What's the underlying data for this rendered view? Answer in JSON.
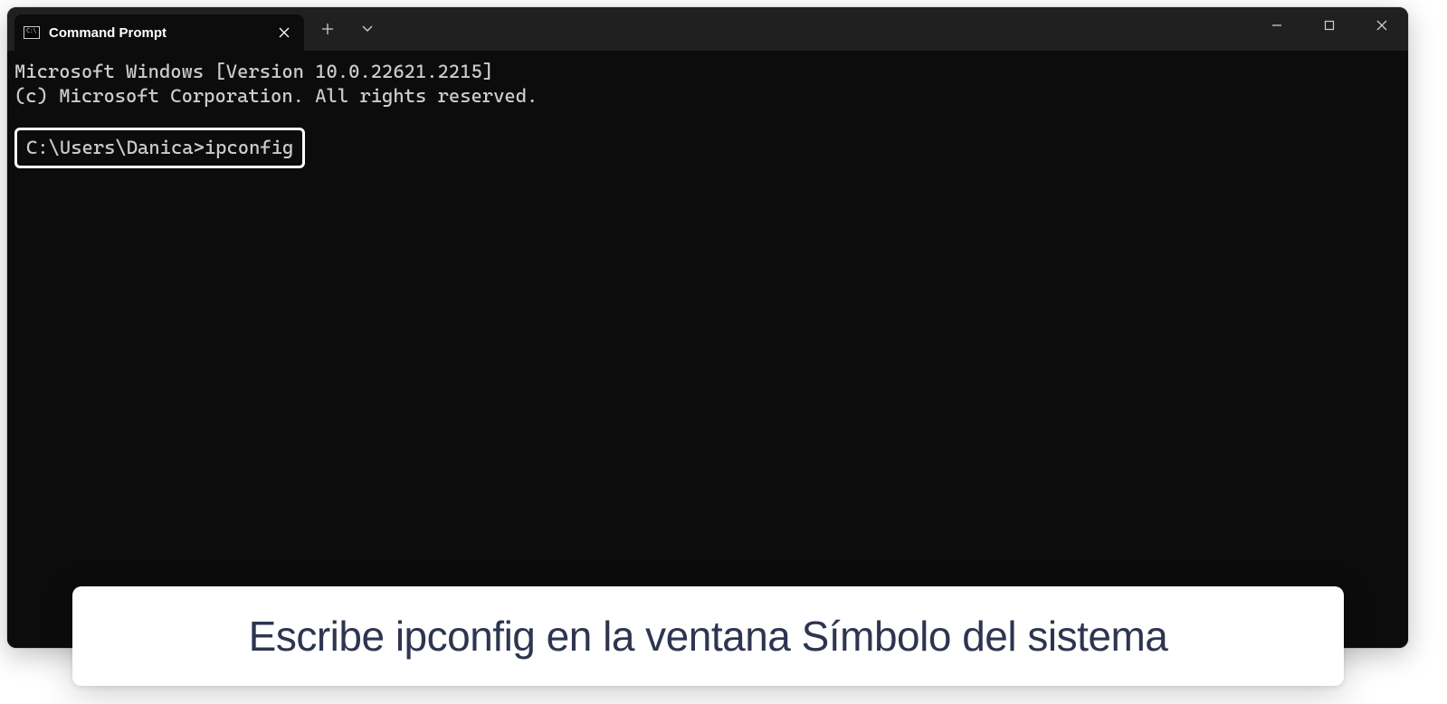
{
  "tab": {
    "title": "Command Prompt",
    "icon_label": "C:\\"
  },
  "terminal": {
    "banner1": "Microsoft Windows [Version 10.0.22621.2215]",
    "banner2": "(c) Microsoft Corporation. All rights reserved.",
    "prompt": "C:\\Users\\Danica>",
    "command": "ipconfig"
  },
  "caption": {
    "text": "Escribe ipconfig en la ventana Símbolo del sistema"
  }
}
